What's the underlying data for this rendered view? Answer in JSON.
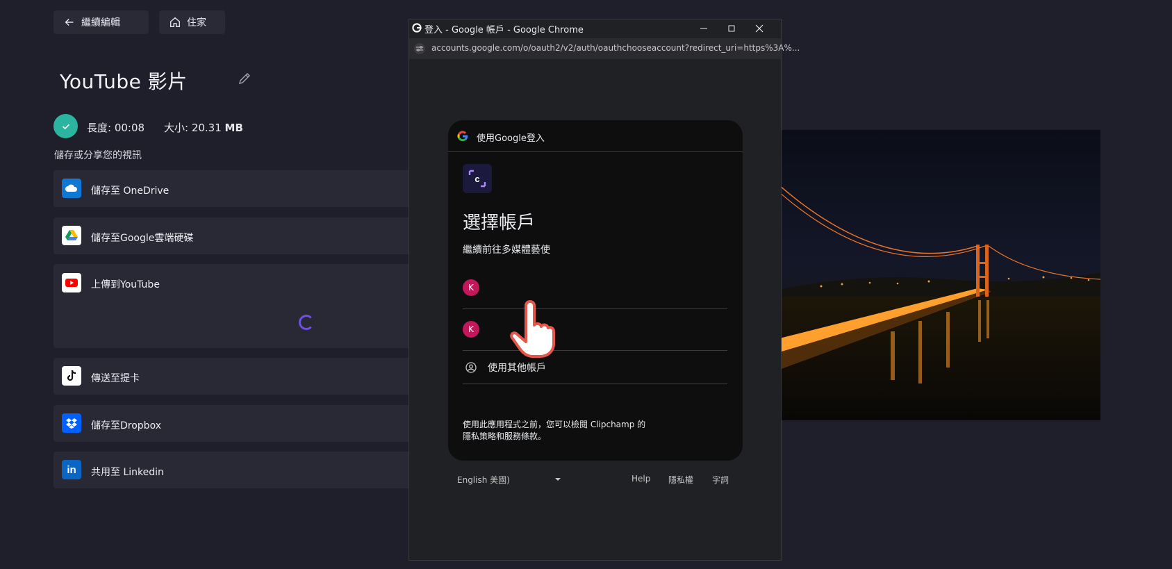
{
  "nav": {
    "back_label": "繼續編輯",
    "home_label": "住家"
  },
  "video": {
    "title": "YouTube 影片",
    "duration_label": "長度: 00:08",
    "size_prefix": "大小: 20.31",
    "size_unit": "MB",
    "share_heading": "儲存或分享您的視訊"
  },
  "destinations": [
    {
      "label": "儲存至 OneDrive",
      "icon": "onedrive-icon"
    },
    {
      "label": "儲存至Google雲端硬碟",
      "icon": "google-drive-icon"
    },
    {
      "label": "上傳到YouTube",
      "icon": "youtube-icon"
    },
    {
      "label": "傳送至提卡",
      "icon": "tiktok-icon"
    },
    {
      "label": "儲存至Dropbox",
      "icon": "dropbox-icon"
    },
    {
      "label": "共用至 Linkedin",
      "icon": "linkedin-icon"
    }
  ],
  "browser": {
    "window_title": "登入 - Google 帳戶 - Google Chrome",
    "url": "accounts.google.com/o/oauth2/v2/auth/oauthchooseaccount?redirect_uri=https%3A%..."
  },
  "signin": {
    "header": "使用Google登入",
    "heading": "選擇帳戶",
    "subheading": "繼續前往多媒體藝使",
    "accounts": [
      {
        "initial": "K"
      },
      {
        "initial": "K"
      }
    ],
    "other_account": "使用其他帳戶",
    "disclaimer_line1": "使用此應用程式之前，您可以檢閱 Clipchamp 的",
    "disclaimer_line2": "隱私策略和服務條款。"
  },
  "footer": {
    "language": "English 美國)",
    "help": "Help",
    "privacy": "隱私權",
    "terms": "字詞"
  },
  "colors": {
    "accent_green": "#2bb5a0",
    "spinner": "#6f4fe6",
    "avatar": "#c2185b",
    "bg": "#1f1f2b"
  }
}
